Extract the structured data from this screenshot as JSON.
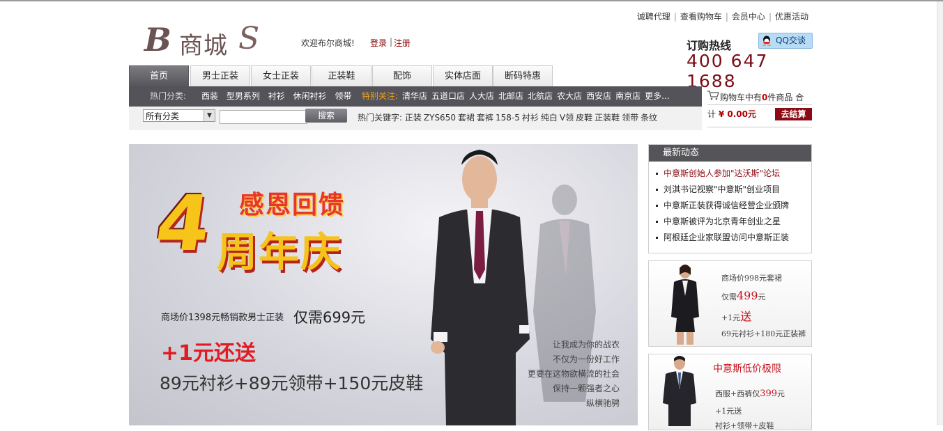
{
  "header": {
    "logo": {
      "letter": "B",
      "name": "商城",
      "flourish": "S"
    },
    "welcome": "欢迎布尔商城!",
    "login": "登录",
    "separator": "|",
    "register": "注册",
    "top_links": [
      "诚聘代理",
      "查看购物车",
      "会员中心",
      "优惠活动"
    ],
    "hotline_label": "订购热线",
    "hotline_number": "400 647 1688",
    "qq_label": "QQ交谈"
  },
  "nav": {
    "tabs": [
      "首页",
      "男士正装",
      "女士正装",
      "正装鞋",
      "配饰",
      "实体店面",
      "断码特惠"
    ],
    "active_index": 0
  },
  "hotbar": {
    "label": "热门分类:",
    "categories": [
      "西装",
      "型男系列",
      "衬衫",
      "休闲衬衫",
      "领带"
    ],
    "special_label": "特别关注:",
    "stores": [
      "清华店",
      "五道口店",
      "人大店",
      "北邮店",
      "北航店",
      "农大店",
      "西安店",
      "南京店",
      "更多..."
    ]
  },
  "search": {
    "category_selected": "所有分类",
    "button": "搜索",
    "keywords_label": "热门关键字:",
    "keywords": [
      "正装",
      "ZYS650",
      "套裙",
      "套裤",
      "158-5",
      "衬衫",
      "纯白",
      "V领",
      "皮鞋",
      "正装鞋",
      "领带",
      "条纹"
    ]
  },
  "cart": {
    "text_before": "购物车中有",
    "count": "0",
    "text_after": "件商品 合",
    "total_prefix": "计",
    "total": "¥ 0.00元",
    "checkout": "去结算"
  },
  "banner": {
    "big_number": "4",
    "thanks": "感恩回馈",
    "anniversary": "周年庆",
    "market_price_text": "商场价1398元畅销款男士正装",
    "offer_price": "仅需699元",
    "plus_offer": "+1元还送",
    "gifts": "89元衬衫+89元领带+150元皮鞋",
    "slogan": [
      "让我成为你的战衣",
      "不仅为一份好工作",
      "更要在这物欲横流的社会",
      "保持一颗强者之心",
      "纵横驰骋"
    ]
  },
  "news": {
    "title": "最新动态",
    "items": [
      "中意斯创始人参加\"达沃斯\"论坛",
      "刘淇书记视察\"中意斯\"创业项目",
      "中意斯正装获得诚信经营企业颁牌",
      "中意斯被评为北京青年创业之星",
      "阿根廷企业家联盟访问中意斯正装"
    ]
  },
  "promo1": {
    "market": "商场价998元套裙",
    "only_prefix": "仅需",
    "price": "499",
    "price_unit": "元",
    "plus_prefix": "+1元",
    "plus_gift": "送",
    "gift_detail": "69元衬衫+180元正装裤"
  },
  "promo2": {
    "title": "中意斯低价极限",
    "line": "西服+西裤仅",
    "price": "399",
    "price_unit": "元",
    "plus": "+1元送",
    "gift_detail": "衬衫+领带+皮鞋"
  },
  "colors": {
    "brand_dark": "#535359",
    "accent_red": "#8b0a14",
    "banner_yellow": "#f6c31c",
    "banner_red": "#e01b22"
  }
}
